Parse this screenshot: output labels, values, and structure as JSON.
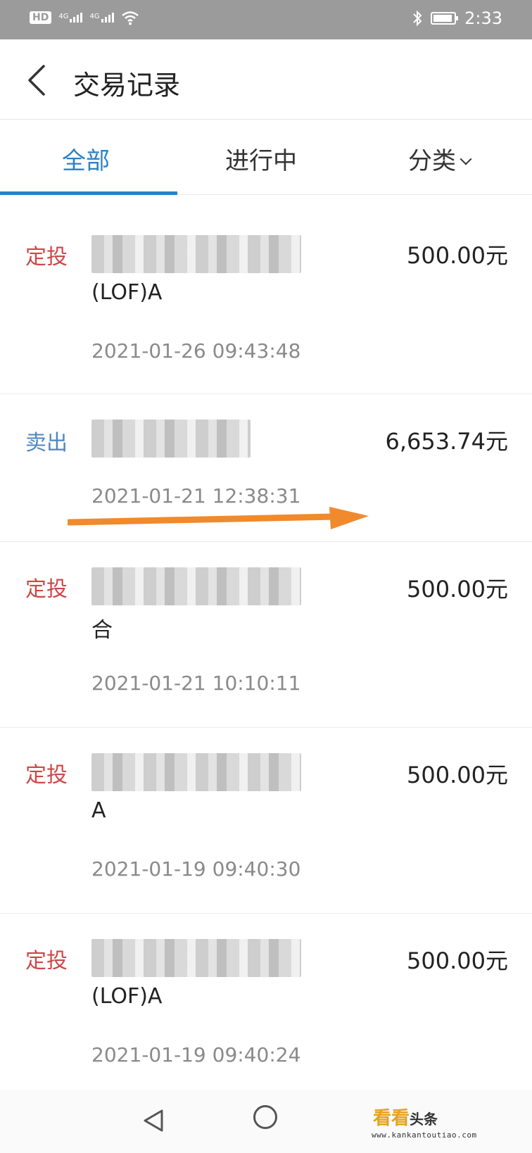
{
  "status_bar": {
    "hd": "HD",
    "net1": "4G",
    "net2": "4G",
    "time": "2:33"
  },
  "header": {
    "title": "交易记录"
  },
  "tabs": [
    {
      "label": "全部",
      "active": true
    },
    {
      "label": "进行中",
      "active": false
    },
    {
      "label": "分类",
      "active": false
    }
  ],
  "transactions": [
    {
      "type": "定投",
      "name_line2": "(LOF)A",
      "time": "2021-01-26 09:43:48",
      "amount": "500.00元"
    },
    {
      "type": "卖出",
      "name_line2": "",
      "time": "2021-01-21 12:38:31",
      "amount": "6,653.74元"
    },
    {
      "type": "定投",
      "name_line2": "合",
      "time": "2021-01-21 10:10:11",
      "amount": "500.00元"
    },
    {
      "type": "定投",
      "name_line2": "A",
      "time": "2021-01-19 09:40:30",
      "amount": "500.00元"
    },
    {
      "type": "定投",
      "name_line2": "(LOF)A",
      "time": "2021-01-19 09:40:24",
      "amount": "500.00元"
    }
  ],
  "colors": {
    "accent": "#2a82c4",
    "type_invest": "#cf4747",
    "type_sell": "#4f86c0",
    "annotation_arrow": "#f08a2c"
  },
  "watermark": {
    "main": "看看",
    "sub": "头条",
    "url": "www.kankantoutiao.com"
  }
}
